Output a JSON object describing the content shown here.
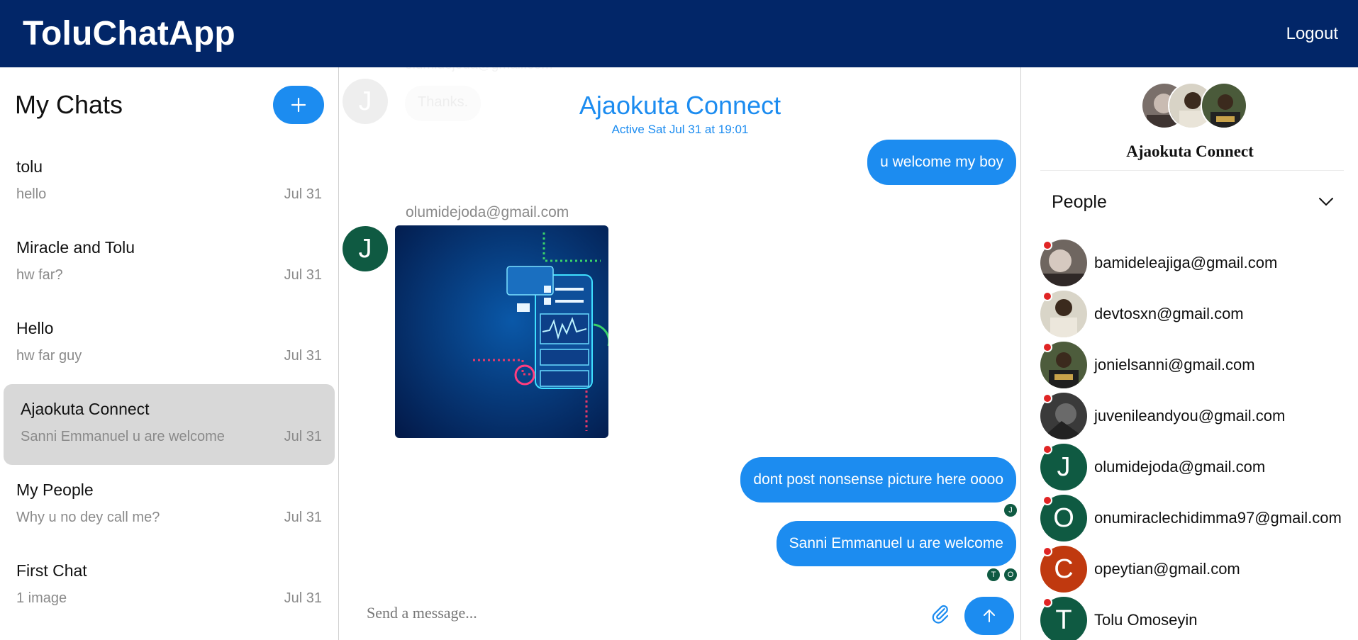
{
  "header": {
    "brand": "ToluChatApp",
    "logout_label": "Logout"
  },
  "sidebar": {
    "title": "My Chats",
    "new_chat_icon": "plus-icon",
    "chats": [
      {
        "name": "tolu",
        "last_message": "hello",
        "date": "Jul 31",
        "active": false
      },
      {
        "name": "Miracle and Tolu",
        "last_message": "hw far?",
        "date": "Jul 31",
        "active": false
      },
      {
        "name": "Hello",
        "last_message": "hw far guy",
        "date": "Jul 31",
        "active": false
      },
      {
        "name": "Ajaokuta Connect",
        "last_message": "Sanni Emmanuel u are welcome",
        "date": "Jul 31",
        "active": true
      },
      {
        "name": "My People",
        "last_message": "Why u no dey call me?",
        "date": "Jul 31",
        "active": false
      },
      {
        "name": "First Chat",
        "last_message": "1 image",
        "date": "Jul 31",
        "active": false
      }
    ]
  },
  "conversation": {
    "title": "Ajaokuta Connect",
    "status": "Active Sat Jul 31 at 19:01",
    "faded_email": "olumidejoda@gmail.com",
    "faded_message": "Thanks.",
    "faded_avatar_letter": "J",
    "messages": {
      "out1": "u welcome my boy",
      "image_sender": "olumidejoda@gmail.com",
      "image_avatar_letter": "J",
      "out2": "dont post nonsense picture here oooo",
      "out3": "Sanni Emmanuel u are welcome"
    },
    "read_receipts": {
      "after_out2": [
        "J"
      ],
      "after_out3": [
        "T",
        "O"
      ]
    },
    "composer": {
      "placeholder": "Send a message..."
    }
  },
  "details": {
    "group_name": "Ajaokuta Connect",
    "people_title": "People",
    "people": [
      {
        "label": "bamideleajiga@gmail.com",
        "avatar": "photo",
        "letter": ""
      },
      {
        "label": "devtosxn@gmail.com",
        "avatar": "photo",
        "letter": ""
      },
      {
        "label": "jonielsanni@gmail.com",
        "avatar": "photo",
        "letter": ""
      },
      {
        "label": "juvenileandyou@gmail.com",
        "avatar": "photo",
        "letter": ""
      },
      {
        "label": "olumidejoda@gmail.com",
        "avatar": "letter",
        "letter": "J"
      },
      {
        "label": "onumiraclechidimma97@gmail.com",
        "avatar": "letter",
        "letter": "O"
      },
      {
        "label": "opeytian@gmail.com",
        "avatar": "letter",
        "letter": "C"
      },
      {
        "label": "Tolu Omoseyin",
        "avatar": "letter",
        "letter": "T"
      }
    ]
  },
  "colors": {
    "header": "#022668",
    "accent": "#1c8cf0",
    "avatar_green": "#0f5a42",
    "avatar_orange": "#c0390f",
    "presence": "#e02424"
  }
}
